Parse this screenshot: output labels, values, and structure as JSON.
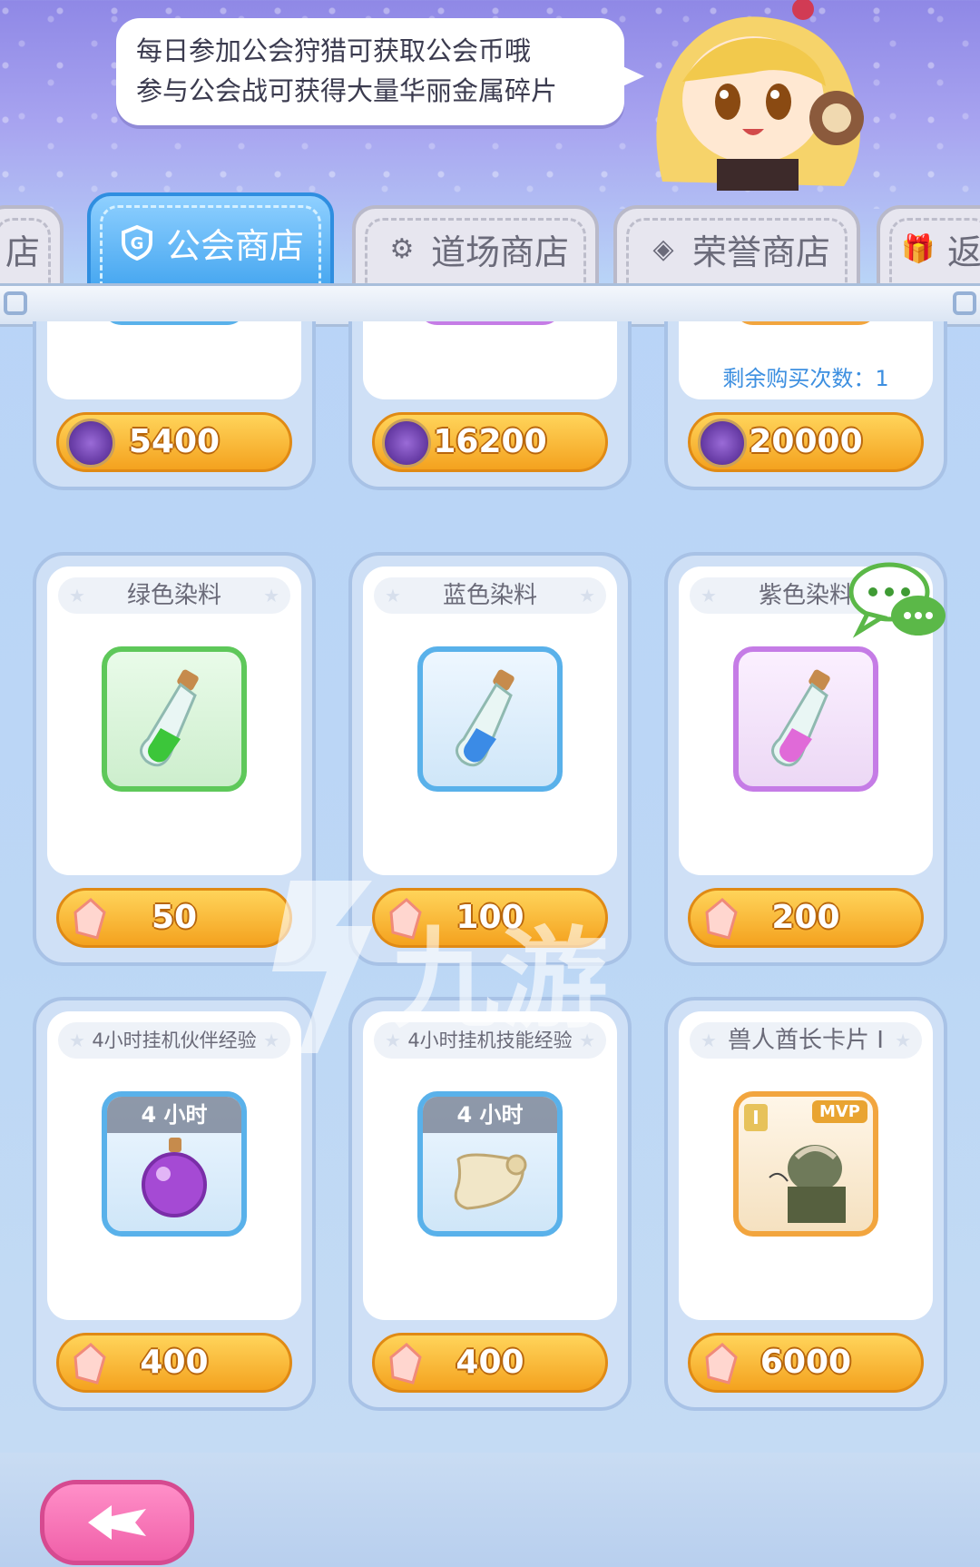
{
  "tip": {
    "line1": "每日参加公会狩猎可获取公会币哦",
    "line2": "参与公会战可获得大量华丽金属碎片"
  },
  "tabs": [
    {
      "label": "店",
      "icon": "shop-icon"
    },
    {
      "label": "公会商店",
      "icon": "guild-g-icon",
      "active": true
    },
    {
      "label": "道场商店",
      "icon": "gear-icon"
    },
    {
      "label": "荣誉商店",
      "icon": "diamond-icon"
    },
    {
      "label": "返",
      "icon": "gift-icon"
    }
  ],
  "row_top": [
    {
      "price": "5400",
      "currency": "guild-coin-icon"
    },
    {
      "price": "16200",
      "currency": "guild-coin-icon"
    },
    {
      "price": "20000",
      "currency": "guild-coin-icon",
      "remaining": "剩余购买次数：1"
    }
  ],
  "row_dyes": [
    {
      "name": "绿色染料",
      "price": "50",
      "color": "#3cc63a",
      "currency": "crystal-icon"
    },
    {
      "name": "蓝色染料",
      "price": "100",
      "color": "#3b8be6",
      "currency": "crystal-icon"
    },
    {
      "name": "紫色染料",
      "price": "200",
      "color": "#e06ad8",
      "currency": "crystal-icon"
    }
  ],
  "row_bottom": [
    {
      "name": "4小时挂机伙伴经验",
      "badge": "4 小时",
      "price": "400",
      "currency": "crystal-icon"
    },
    {
      "name": "4小时挂机技能经验",
      "badge": "4 小时",
      "price": "400",
      "currency": "crystal-icon"
    },
    {
      "name": "兽人酋长卡片 I",
      "badge": "MVP",
      "rank": "I",
      "price": "6000",
      "currency": "crystal-icon"
    }
  ],
  "watermark": "九游",
  "colors": {
    "accent": "#45a6f0",
    "price": "#f4a21f",
    "back": "#f05fa8"
  }
}
